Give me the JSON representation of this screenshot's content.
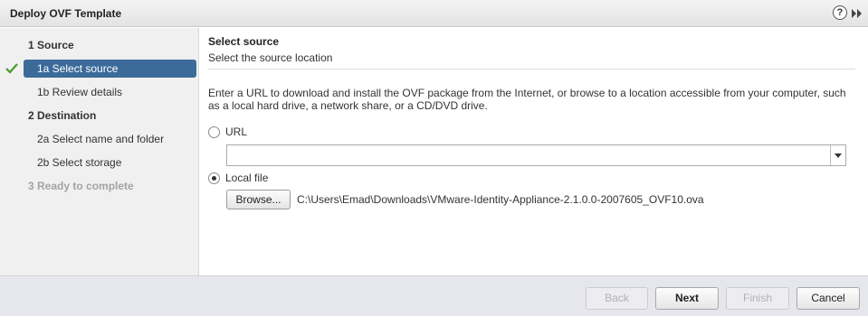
{
  "window": {
    "title": "Deploy OVF Template",
    "help_glyph": "?",
    "icons": [
      "help-icon",
      "expand-icon"
    ]
  },
  "steps": [
    {
      "label": "1  Source",
      "kind": "section",
      "state": "normal"
    },
    {
      "label": "1a  Select source",
      "kind": "sub",
      "state": "selected",
      "completed": true
    },
    {
      "label": "1b  Review details",
      "kind": "sub",
      "state": "normal"
    },
    {
      "label": "2  Destination",
      "kind": "section",
      "state": "normal"
    },
    {
      "label": "2a  Select name and folder",
      "kind": "sub",
      "state": "normal"
    },
    {
      "label": "2b  Select storage",
      "kind": "sub",
      "state": "normal"
    },
    {
      "label": "3  Ready to complete",
      "kind": "section",
      "state": "disabled"
    }
  ],
  "content": {
    "heading": "Select source",
    "subheading": "Select the source location",
    "intro": "Enter a URL to download and install the OVF package from the Internet, or browse to a location accessible from your computer, such as a local hard drive, a network share, or a CD/DVD drive.",
    "url_option": {
      "label": "URL",
      "selected": false
    },
    "url_value": "",
    "local_option": {
      "label": "Local file",
      "selected": true
    },
    "browse_label": "Browse...",
    "file_path": "C:\\Users\\Emad\\Downloads\\VMware-Identity-Appliance-2.1.0.0-2007605_OVF10.ova"
  },
  "footer": {
    "back_label": "Back",
    "next_label": "Next",
    "finish_label": "Finish",
    "cancel_label": "Cancel"
  },
  "colors": {
    "selected_step_bg": "#3c6b9a",
    "check_green": "#4a9a2a",
    "sidebar_bg": "#f0f0f0",
    "footer_bg": "#e6e6ed"
  }
}
